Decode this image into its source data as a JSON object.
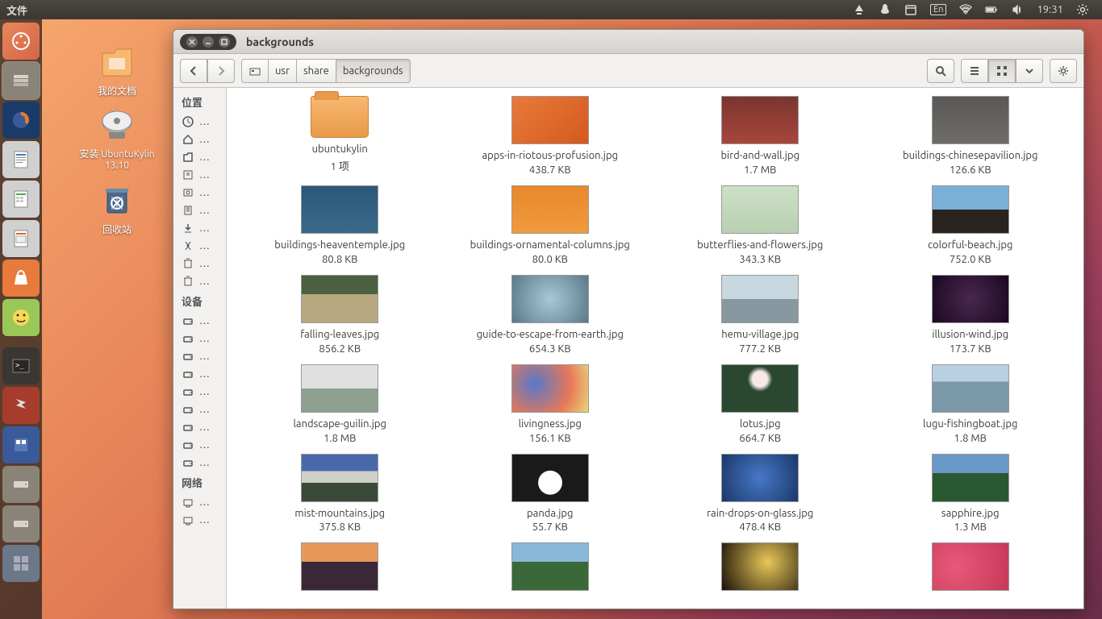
{
  "top_panel": {
    "menu": "文件",
    "lang": "En",
    "time": "19:31"
  },
  "desktop": [
    {
      "name": "我的文档"
    },
    {
      "name": "安装 UbuntuKylin 13.10"
    },
    {
      "name": "回收站"
    }
  ],
  "window": {
    "title": "backgrounds",
    "breadcrumb": [
      "usr",
      "share",
      "backgrounds"
    ]
  },
  "sidebar": {
    "sections": [
      {
        "heading": "位置",
        "items": [
          "…",
          "…",
          "…",
          "…",
          "…",
          "…",
          "…",
          "…",
          "…",
          "…"
        ]
      },
      {
        "heading": "设备",
        "items": [
          "…",
          "…",
          "…",
          "…",
          "…",
          "…",
          "…",
          "…",
          "…"
        ]
      },
      {
        "heading": "网络",
        "items": [
          "…",
          "…"
        ]
      }
    ]
  },
  "files": [
    {
      "name": "ubuntukylin",
      "size": "1 项",
      "type": "folder"
    },
    {
      "name": "apps-in-riotous-profusion.jpg",
      "size": "438.7 KB",
      "bg": "linear-gradient(135deg,#e87a3c,#d45a1e)"
    },
    {
      "name": "bird-and-wall.jpg",
      "size": "1.7 MB",
      "bg": "linear-gradient(to bottom,#7a3530,#a8463c)"
    },
    {
      "name": "buildings-chinesepavilion.jpg",
      "size": "126.6 KB",
      "bg": "linear-gradient(to bottom,#5a5856,#6e6c68)"
    },
    {
      "name": "buildings-heaventemple.jpg",
      "size": "80.8 KB",
      "bg": "linear-gradient(to bottom,#2c5878,#3a6a8a)"
    },
    {
      "name": "buildings-ornamental-columns.jpg",
      "size": "80.0 KB",
      "bg": "linear-gradient(to bottom,#e8882c,#f09a3e)"
    },
    {
      "name": "butterflies-and-flowers.jpg",
      "size": "343.3 KB",
      "bg": "linear-gradient(to bottom,#cde0c8,#b8d0b0)"
    },
    {
      "name": "colorful-beach.jpg",
      "size": "752.0 KB",
      "bg": "linear-gradient(to bottom,#7ab0d8 50%,#2a2420 50%)"
    },
    {
      "name": "falling-leaves.jpg",
      "size": "856.2 KB",
      "bg": "linear-gradient(to bottom,#4a6040 40%,#b8a880 40%)"
    },
    {
      "name": "guide-to-escape-from-earth.jpg",
      "size": "654.3 KB",
      "bg": "radial-gradient(circle,#a8c8d8,#5a7888)"
    },
    {
      "name": "hemu-village.jpg",
      "size": "777.2 KB",
      "bg": "linear-gradient(to bottom,#c8d8e0 50%,#8898a0 50%)"
    },
    {
      "name": "illusion-wind.jpg",
      "size": "173.7 KB",
      "bg": "radial-gradient(circle,#4a2850,#1a0820)"
    },
    {
      "name": "landscape-guilin.jpg",
      "size": "1.8 MB",
      "bg": "linear-gradient(to bottom,#e0e0e0 50%,#90a090 50%)"
    },
    {
      "name": "livingness.jpg",
      "size": "156.1 KB",
      "bg": "radial-gradient(circle at 30% 40%,#5878c8,#e87858 60%,#e8d878)"
    },
    {
      "name": "lotus.jpg",
      "size": "664.7 KB",
      "bg": "radial-gradient(circle at 50% 30%,#f8e8e8 15%,#2a4830 25%)"
    },
    {
      "name": "lugu-fishingboat.jpg",
      "size": "1.8 MB",
      "bg": "linear-gradient(to bottom,#b8d0e0 35%,#7a98a8 35%)"
    },
    {
      "name": "mist-mountains.jpg",
      "size": "375.8 KB",
      "bg": "linear-gradient(to bottom,#4a68a8 35%,#d0d0c8 35% 60%,#3a4838 60%)"
    },
    {
      "name": "panda.jpg",
      "size": "55.7 KB",
      "bg": "radial-gradient(circle at 50% 60%,#fff 25%,#1a1a1a 26%)"
    },
    {
      "name": "rain-drops-on-glass.jpg",
      "size": "478.4 KB",
      "bg": "radial-gradient(circle,#4878c8,#1a3868)"
    },
    {
      "name": "sapphire.jpg",
      "size": "1.3 MB",
      "bg": "linear-gradient(to bottom,#6898c8 40%,#2a5830 40%)"
    },
    {
      "name": "",
      "size": "",
      "bg": "linear-gradient(to bottom,#e8985a 40%,#3a2838 40%)"
    },
    {
      "name": "",
      "size": "",
      "bg": "linear-gradient(to bottom,#88b8d8 40%,#3a6838 40%)"
    },
    {
      "name": "",
      "size": "",
      "bg": "radial-gradient(circle at 60% 40%,#e8c858,#1a1008)"
    },
    {
      "name": "",
      "size": "",
      "bg": "radial-gradient(circle at 30% 50%,#e85878,#c83858)"
    }
  ]
}
